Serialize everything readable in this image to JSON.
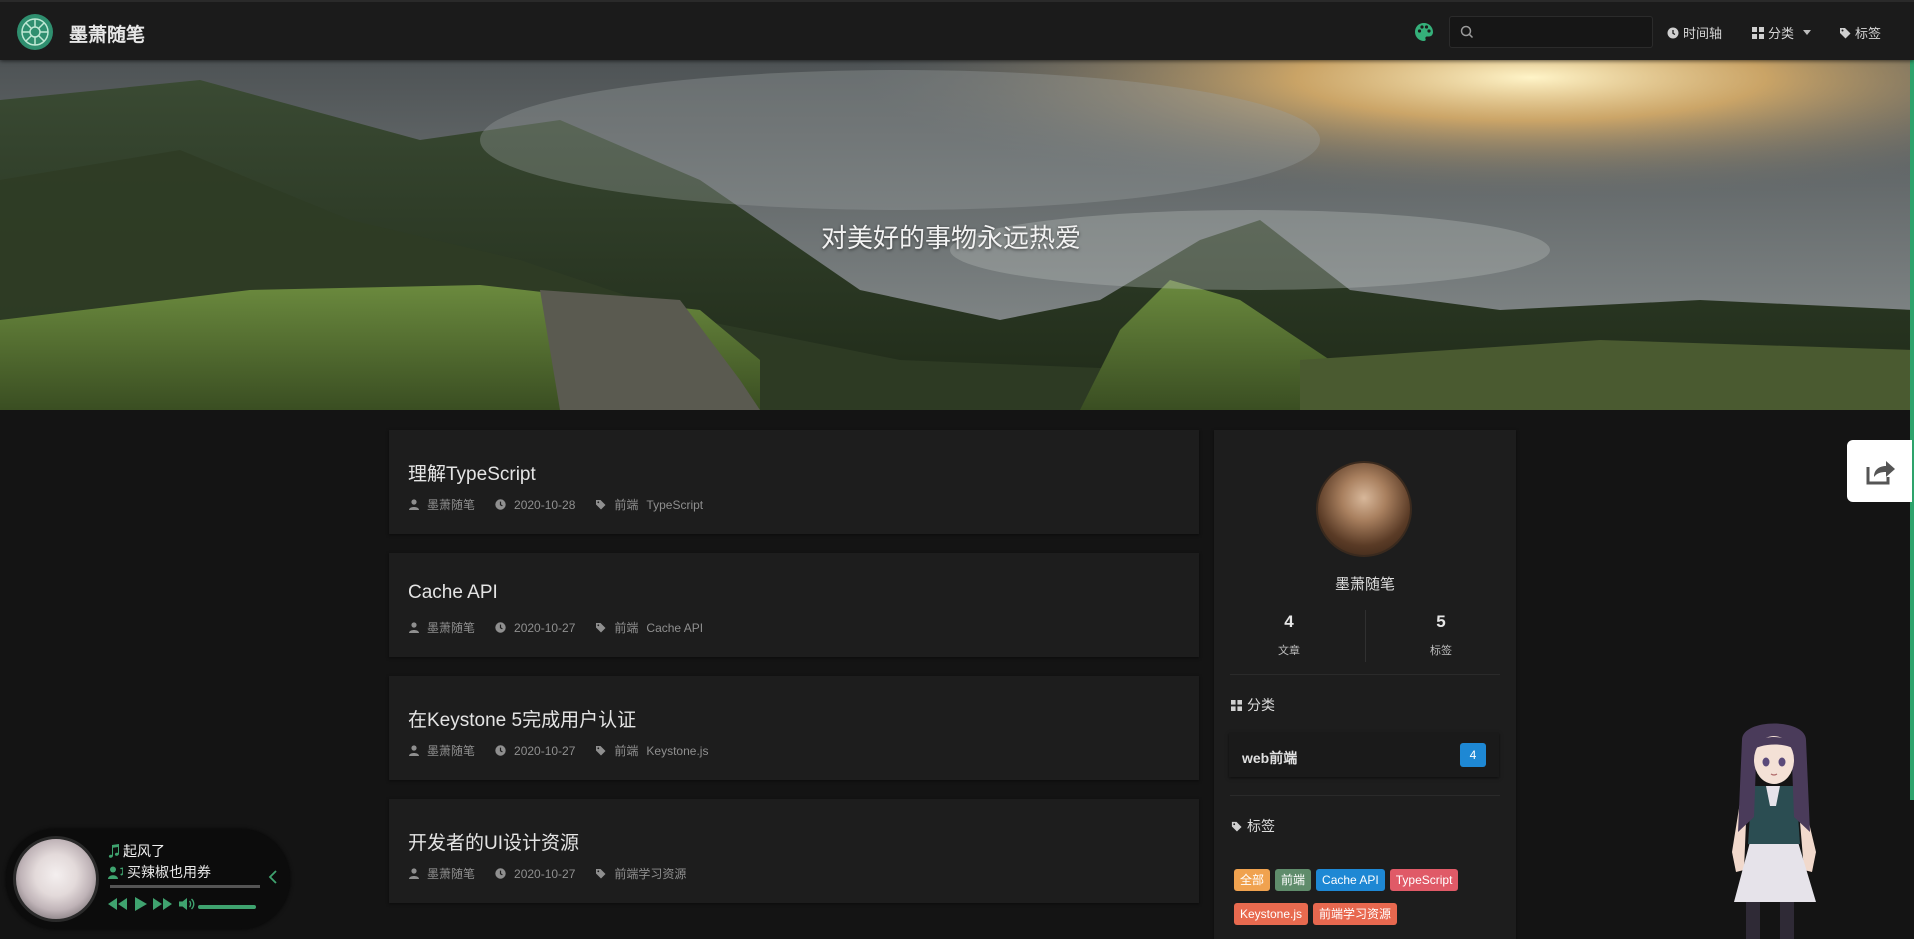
{
  "header": {
    "site_title": "墨萧随笔",
    "search_placeholder": "",
    "nav": {
      "timeline": "时间轴",
      "categories": "分类",
      "tags": "标签"
    }
  },
  "hero": {
    "slogan": "对美好的事物永远热爱"
  },
  "posts": [
    {
      "title": "理解TypeScript",
      "author": "墨萧随笔",
      "date": "2020-10-28",
      "category": "前端",
      "tag": "TypeScript"
    },
    {
      "title": "Cache API",
      "author": "墨萧随笔",
      "date": "2020-10-27",
      "category": "前端",
      "tag": "Cache API"
    },
    {
      "title": "在Keystone 5完成用户认证",
      "author": "墨萧随笔",
      "date": "2020-10-27",
      "category": "前端",
      "tag": "Keystone.js"
    },
    {
      "title": "开发者的UI设计资源",
      "author": "墨萧随笔",
      "date": "2020-10-27",
      "category": "前端学习资源",
      "tag": ""
    }
  ],
  "sidebar": {
    "author": "墨萧随笔",
    "stats": {
      "articles": {
        "value": "4",
        "label": "文章"
      },
      "tags": {
        "value": "5",
        "label": "标签"
      }
    },
    "categories_heading": "分类",
    "categories": [
      {
        "name": "web前端",
        "count": "4"
      }
    ],
    "tags_heading": "标签",
    "tags": [
      {
        "label": "全部",
        "color": "#f0a24f"
      },
      {
        "label": "前端",
        "color": "#5f8c6b"
      },
      {
        "label": "Cache API",
        "color": "#1e88d4"
      },
      {
        "label": "TypeScript",
        "color": "#e05a67"
      },
      {
        "label": "Keystone.js",
        "color": "#e86a4f"
      },
      {
        "label": "前端学习资源",
        "color": "#e8684f"
      }
    ]
  },
  "player": {
    "song": "起风了",
    "artist": "买辣椒也用券",
    "progress": 0.0
  },
  "colors": {
    "accent": "#2ea36c",
    "background": "#141414",
    "card": "#1d1d1d",
    "badge": "#1e88d4"
  }
}
